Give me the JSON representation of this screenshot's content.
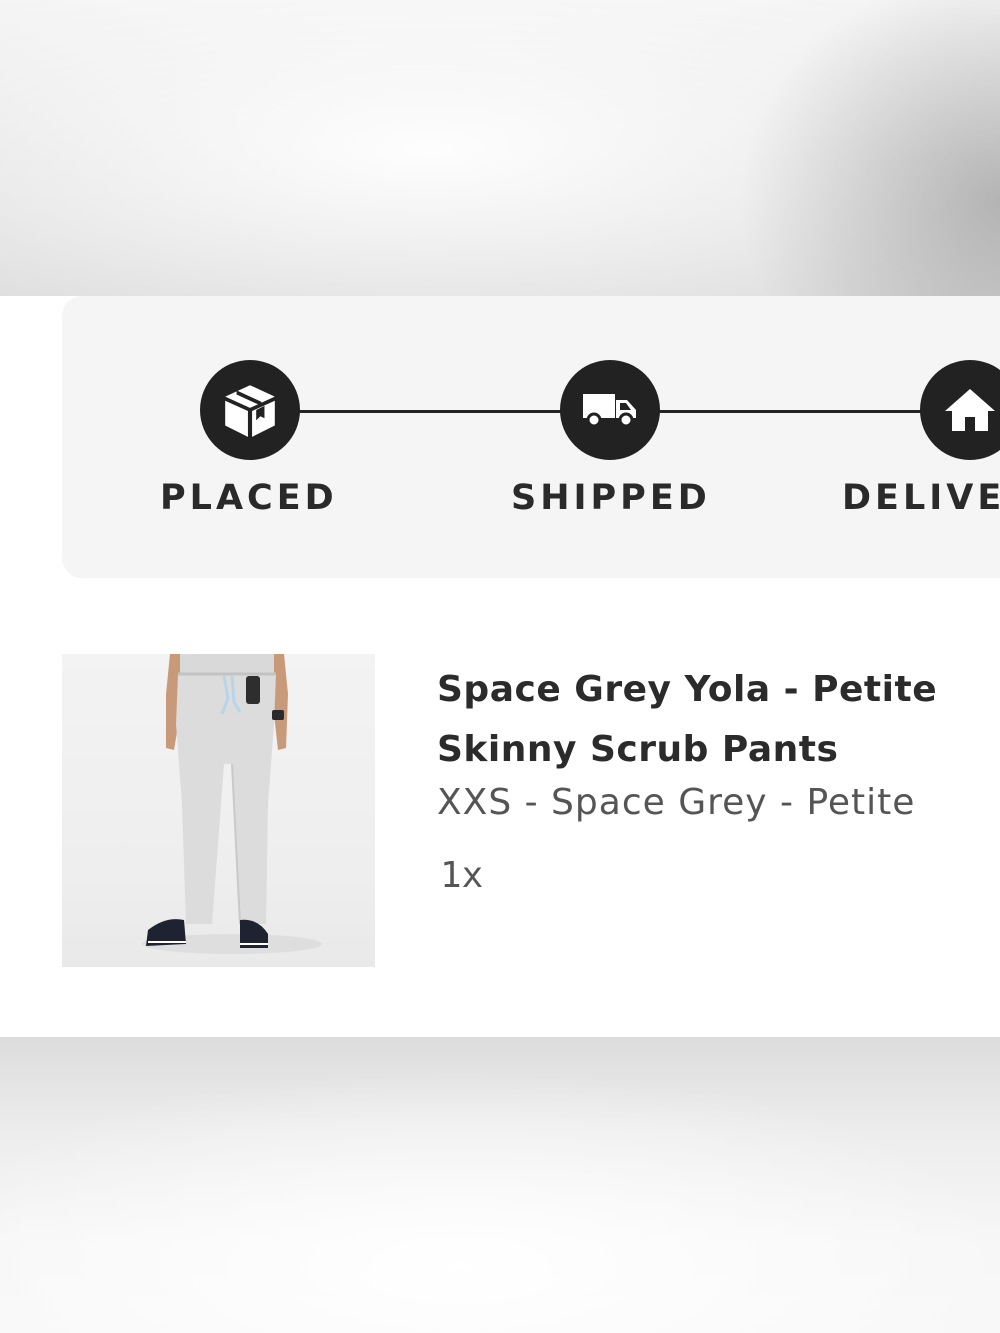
{
  "tracker": {
    "steps": [
      {
        "label": "PLACED",
        "icon": "package-icon"
      },
      {
        "label": "SHIPPED",
        "icon": "truck-icon"
      },
      {
        "label": "DELIVE",
        "icon": "house-icon"
      }
    ]
  },
  "item": {
    "title_line1": "Space Grey Yola - Petite",
    "title_line2": "Skinny Scrub Pants",
    "variant": "XXS - Space Grey - Petite",
    "quantity": "1x"
  },
  "colors": {
    "icon_background": "#222222",
    "tracker_background": "#f5f5f5",
    "title_text": "#2b2b2b",
    "secondary_text": "#555555"
  }
}
